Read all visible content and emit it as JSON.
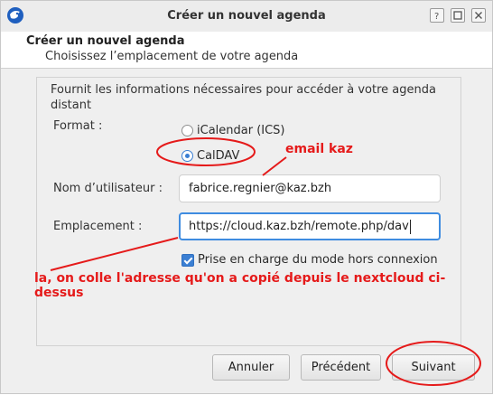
{
  "window": {
    "title": "Créer un nouvel agenda"
  },
  "header": {
    "title": "Créer un nouvel agenda",
    "subtitle": "Choisissez l’emplacement de votre agenda"
  },
  "form": {
    "description": "Fournit les informations nécessaires pour accéder à votre agenda distant",
    "format_label": "Format  :",
    "format_options": [
      {
        "label": "iCalendar (ICS)",
        "selected": false
      },
      {
        "label": "CalDAV",
        "selected": true
      }
    ],
    "username_label": "Nom d’utilisateur  :",
    "username_value": "fabrice.regnier@kaz.bzh",
    "location_label": "Emplacement  :",
    "location_value": "https://cloud.kaz.bzh/remote.php/dav",
    "offline_label": "Prise en charge du mode hors connexion",
    "offline_checked": true
  },
  "buttons": {
    "cancel": "Annuler",
    "previous": "Précédent",
    "next": "Suivant"
  },
  "annotations": {
    "email_note": "email kaz",
    "url_note": "la, on colle l'adresse qu'on a copié depuis le nextcloud ci-dessus",
    "color": "#e51a1a"
  },
  "colors": {
    "accent": "#3b7fd3",
    "focus_border": "#3f8ce0"
  }
}
